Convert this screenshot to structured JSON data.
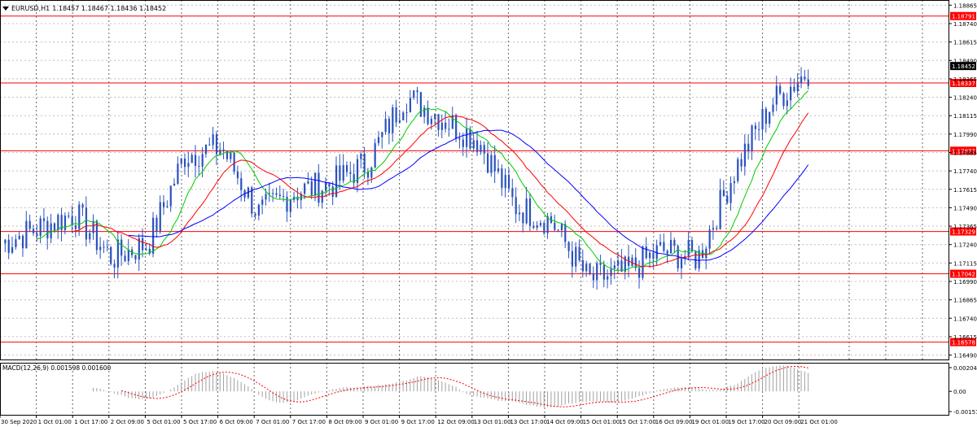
{
  "chart_header": {
    "symbol": "EURUSD,H1",
    "ohlc": "1.18457 1.18467 1.18436 1.18452"
  },
  "macd_header": "MACD(12,26,9) 0.001598 0.001600",
  "price_axis": {
    "ticks": [
      "1.18865",
      "1.18740",
      "1.18615",
      "1.18490",
      "1.18365",
      "1.18240",
      "1.18115",
      "1.17990",
      "1.17865",
      "1.17740",
      "1.17615",
      "1.17490",
      "1.17365",
      "1.17240",
      "1.17115",
      "1.16990",
      "1.16865",
      "1.16740",
      "1.16615",
      "1.16490"
    ],
    "current_price": "1.18452"
  },
  "levels": [
    {
      "label": "1.18791",
      "value": 1.18791
    },
    {
      "label": "1.18337",
      "value": 1.18337
    },
    {
      "label": "1.17877",
      "value": 1.17877
    },
    {
      "label": "1.17329",
      "value": 1.17329
    },
    {
      "label": "1.17042",
      "value": 1.17042
    },
    {
      "label": "1.16578",
      "value": 1.16578
    }
  ],
  "macd_axis": {
    "ticks": [
      "0.00204",
      "0.00",
      "-0.00157"
    ]
  },
  "time_axis": {
    "labels": [
      "30 Sep 2020",
      "1 Oct 01:00",
      "1 Oct 17:00",
      "2 Oct 09:00",
      "5 Oct 01:00",
      "5 Oct 17:00",
      "6 Oct 09:00",
      "7 Oct 01:00",
      "7 Oct 17:00",
      "8 Oct 09:00",
      "9 Oct 01:00",
      "9 Oct 17:00",
      "12 Oct 09:00",
      "13 Oct 01:00",
      "13 Oct 17:00",
      "14 Oct 09:00",
      "15 Oct 01:00",
      "15 Oct 17:00",
      "16 Oct 09:00",
      "19 Oct 01:00",
      "19 Oct 17:00",
      "20 Oct 09:00",
      "21 Oct 01:00"
    ]
  },
  "colors": {
    "level_line": "#ff0000",
    "candles": "#2a52be",
    "ma_fast": "#00cc00",
    "ma_mid": "#ff0000",
    "ma_slow": "#0000ff",
    "macd_hist": "#a0a0a0",
    "macd_signal": "#ff0000",
    "grid": "#c0c0c0",
    "price_label_bg": "#000000"
  },
  "chart_data": {
    "type": "line",
    "title": "EURUSD,H1",
    "ylim": [
      1.1646,
      1.189
    ],
    "x": [
      "30 Sep 2020",
      "1 Oct 01:00",
      "1 Oct 17:00",
      "2 Oct 09:00",
      "5 Oct 01:00",
      "5 Oct 17:00",
      "6 Oct 09:00",
      "7 Oct 01:00",
      "7 Oct 17:00",
      "8 Oct 09:00",
      "9 Oct 01:00",
      "9 Oct 17:00",
      "12 Oct 09:00",
      "13 Oct 01:00",
      "13 Oct 17:00",
      "14 Oct 09:00",
      "15 Oct 01:00",
      "15 Oct 17:00",
      "16 Oct 09:00",
      "19 Oct 01:00",
      "19 Oct 17:00",
      "20 Oct 09:00",
      "21 Oct 01:00"
    ],
    "series": [
      {
        "values": [
          1.1725,
          1.1735,
          1.1745,
          1.1715,
          1.1725,
          1.1785,
          1.179,
          1.1745,
          1.176,
          1.1765,
          1.178,
          1.1825,
          1.181,
          1.1795,
          1.175,
          1.174,
          1.17,
          1.1705,
          1.172,
          1.1715,
          1.1775,
          1.182,
          1.1842
        ]
      },
      {
        "values": [
          1.1718,
          1.1722,
          1.1738,
          1.172,
          1.1718,
          1.177,
          1.1785,
          1.1745,
          1.1758,
          1.1762,
          1.1768,
          1.1815,
          1.1812,
          1.18,
          1.1752,
          1.1745,
          1.1705,
          1.1705,
          1.1718,
          1.1715,
          1.176,
          1.1805,
          1.1835
        ]
      },
      {
        "values": [
          1.1712,
          1.1716,
          1.1732,
          1.1726,
          1.1716,
          1.1758,
          1.178,
          1.175,
          1.1754,
          1.176,
          1.1762,
          1.18,
          1.1813,
          1.1806,
          1.176,
          1.1746,
          1.1712,
          1.1706,
          1.1714,
          1.1715,
          1.1745,
          1.179,
          1.1822
        ]
      },
      {
        "values": [
          1.1708,
          1.1712,
          1.1728,
          1.173,
          1.1716,
          1.1745,
          1.1775,
          1.1765,
          1.1752,
          1.1758,
          1.1758,
          1.1785,
          1.181,
          1.181,
          1.177,
          1.1748,
          1.1732,
          1.1708,
          1.1712,
          1.1715,
          1.1732,
          1.177,
          1.1803
        ]
      }
    ]
  }
}
